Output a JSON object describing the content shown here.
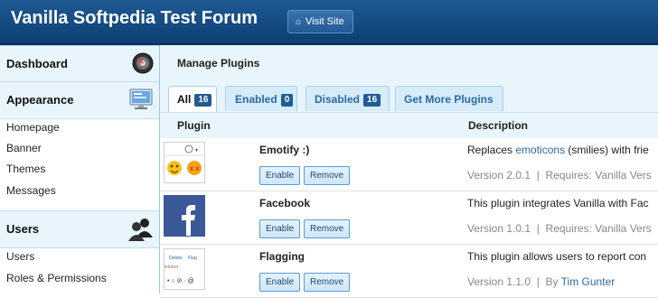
{
  "header": {
    "title": "Vanilla Softpedia Test Forum",
    "visit_site_label": "Visit Site"
  },
  "sidebar": {
    "sections": [
      {
        "label": "Dashboard",
        "icon": "dashboard-gauge-icon",
        "items": []
      },
      {
        "label": "Appearance",
        "icon": "monitor-icon",
        "items": [
          "Homepage",
          "Banner",
          "Themes",
          "Messages"
        ]
      },
      {
        "label": "Users",
        "icon": "users-icon",
        "items": [
          "Users",
          "Roles & Permissions"
        ]
      }
    ]
  },
  "main": {
    "title": "Manage Plugins",
    "tabs": [
      {
        "label": "All",
        "count": "16",
        "active": true
      },
      {
        "label": "Enabled",
        "count": "0",
        "active": false
      },
      {
        "label": "Disabled",
        "count": "16",
        "active": false
      },
      {
        "label": "Get More Plugins",
        "count": null,
        "active": false
      }
    ],
    "columns": [
      "Plugin",
      "Description"
    ],
    "plugins": [
      {
        "name": "Emotify :)",
        "enable_label": "Enable",
        "remove_label": "Remove",
        "desc_prefix": "Replaces ",
        "desc_link": "emoticons",
        "desc_suffix": " (smilies) with frie",
        "version": "Version 2.0.1",
        "sep": "|",
        "extra": "Requires: Vanilla Vers"
      },
      {
        "name": "Facebook",
        "enable_label": "Enable",
        "remove_label": "Remove",
        "desc_prefix": "This plugin integrates Vanilla with Fac",
        "version": "Version 1.0.1",
        "sep": "|",
        "extra": "Requires: Vanilla Vers"
      },
      {
        "name": "Flagging",
        "enable_label": "Enable",
        "remove_label": "Remove",
        "desc_prefix": "This plugin allows users to report con",
        "version": "Version 1.1.0",
        "sep": "|",
        "by_label": "By",
        "author": "Tim Gunter",
        "thumb_words": [
          "Delete",
          "Flag"
        ],
        "thumb_small": "istrator",
        "thumb_symbols": "• ○ ⊘ · @"
      }
    ]
  },
  "colors": {
    "header_bg": "#164c83",
    "accent": "#2b6aa8",
    "panel_bg": "#e9f5fc",
    "badge_bg": "#1f5d94"
  }
}
